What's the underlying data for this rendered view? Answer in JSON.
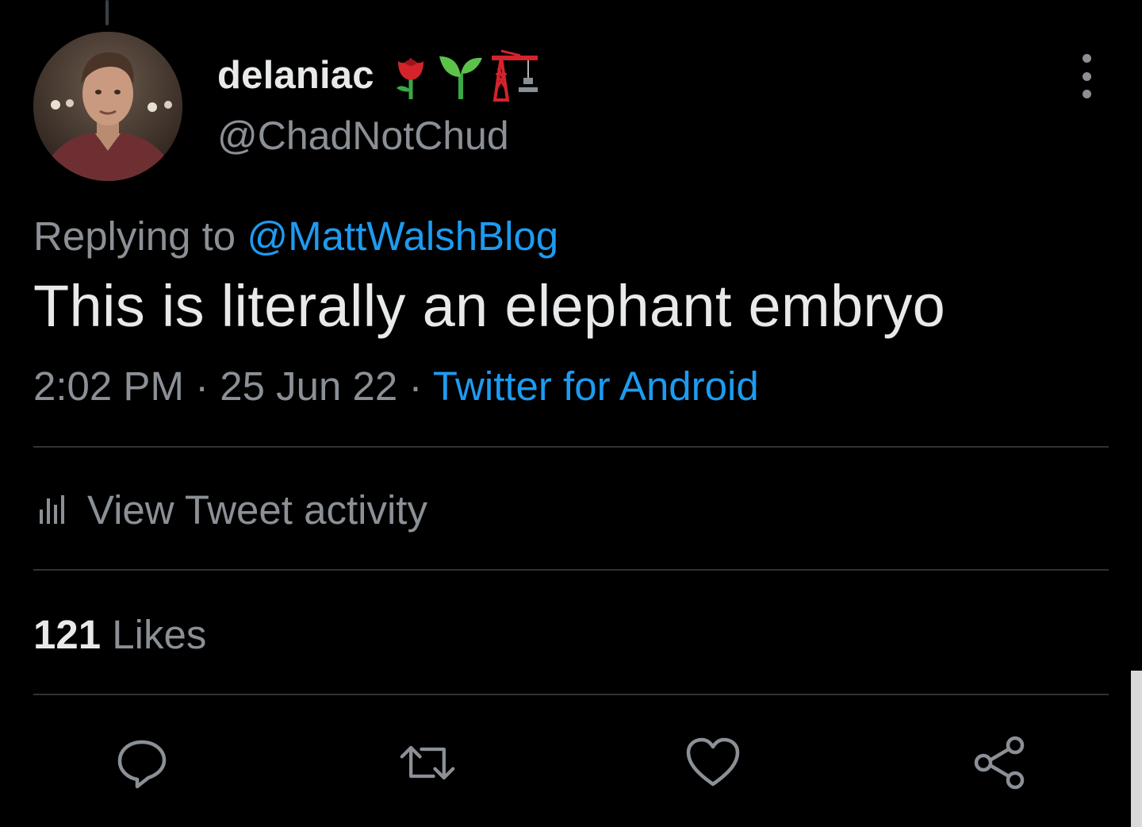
{
  "tweet": {
    "author": {
      "display_name": "delaniac",
      "name_emojis": [
        "rose-icon",
        "seedling-icon",
        "construction-crane-icon"
      ],
      "handle": "@ChadNotChud",
      "avatar": "profile-photo"
    },
    "replying_prefix": "Replying to",
    "replying_to": "@MattWalshBlog",
    "text": "This is literally an elephant embryo",
    "time": "2:02 PM",
    "date": "25 Jun 22",
    "separator": "·",
    "source": "Twitter for Android",
    "activity_label": "View Tweet activity",
    "likes_count": "121",
    "likes_label": "Likes",
    "actions": [
      "reply-icon",
      "retweet-icon",
      "like-icon",
      "share-icon"
    ]
  },
  "colors": {
    "background": "#000000",
    "primary_text": "#e7e9ea",
    "secondary_text": "#8b9096",
    "link": "#1d9bf0",
    "divider": "#2f3336"
  }
}
